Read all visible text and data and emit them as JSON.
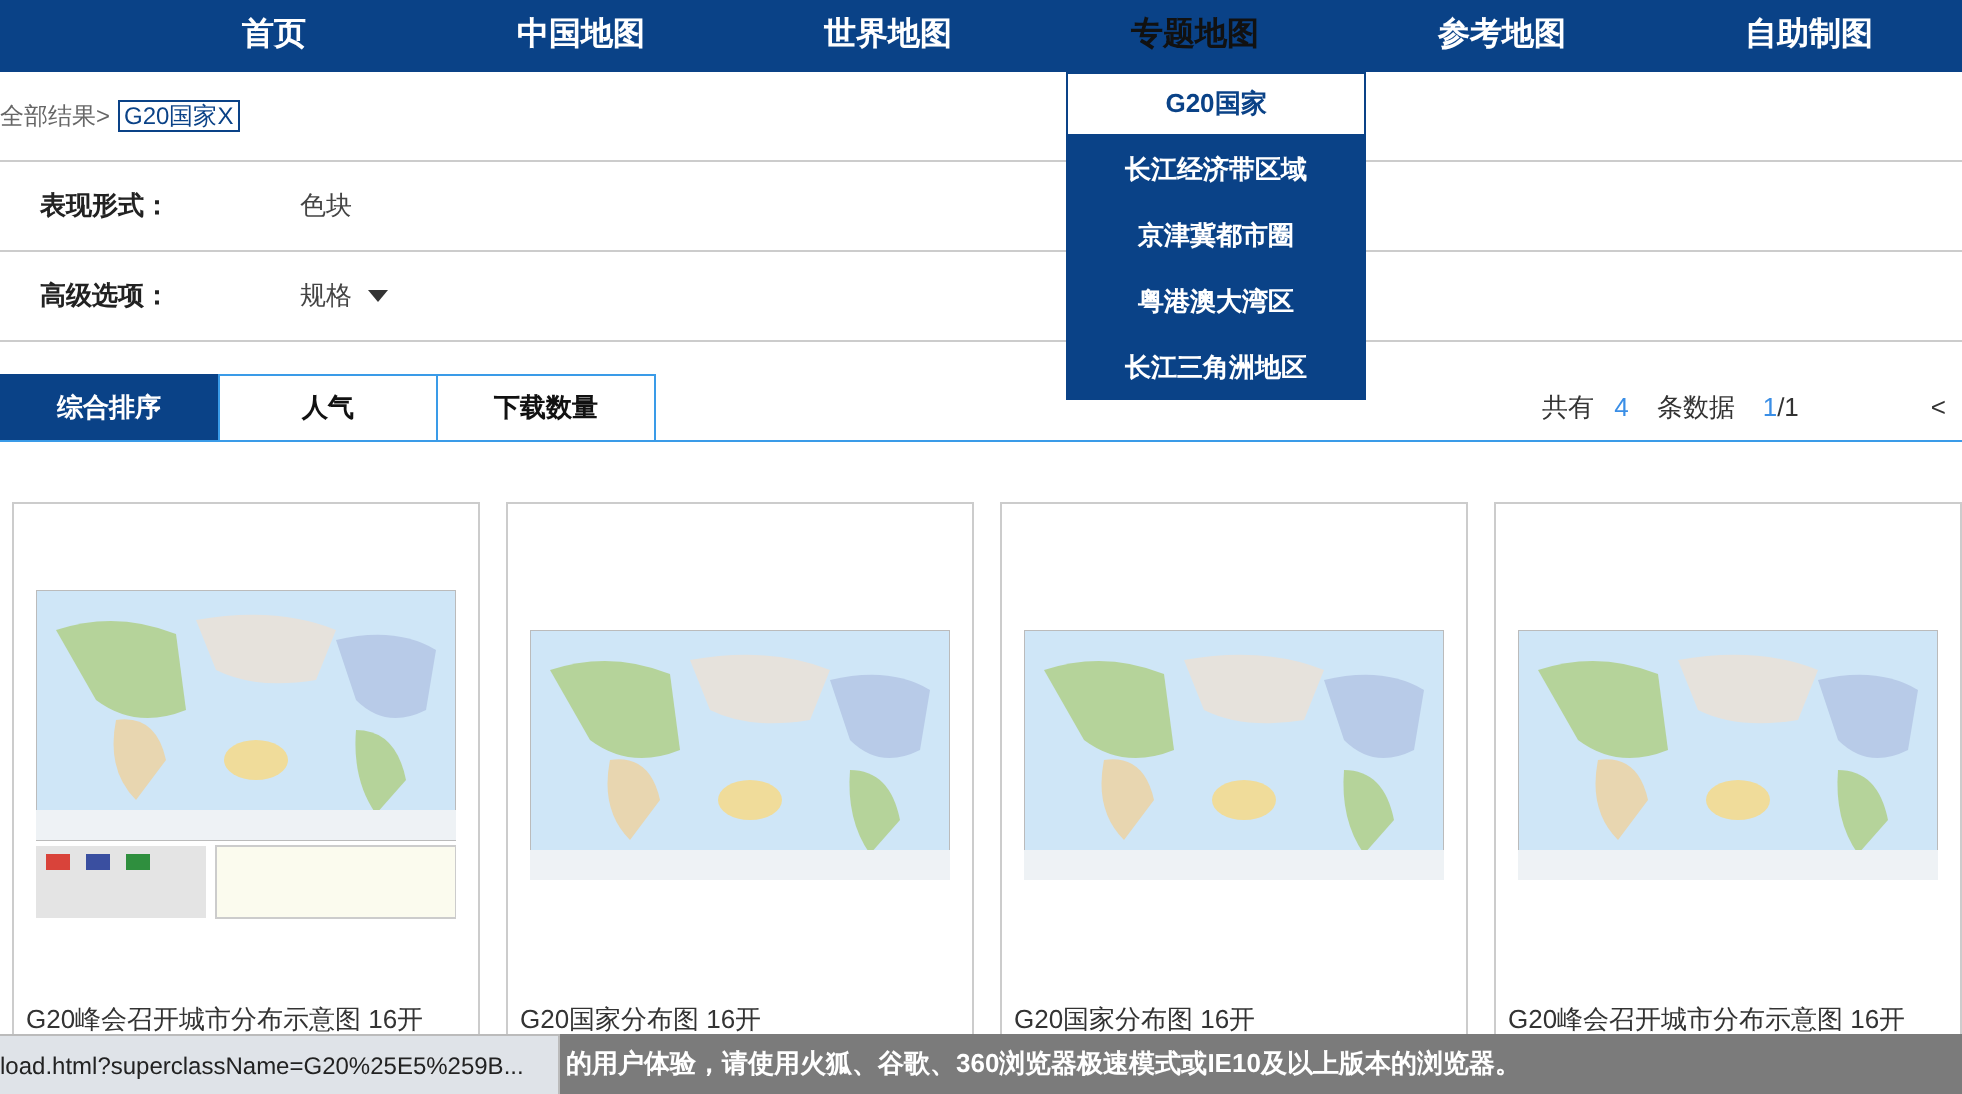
{
  "nav": [
    {
      "label": "首页",
      "selected": false
    },
    {
      "label": "中国地图",
      "selected": false
    },
    {
      "label": "世界地图",
      "selected": false
    },
    {
      "label": "专题地图",
      "selected": true
    },
    {
      "label": "参考地图",
      "selected": false
    },
    {
      "label": "自助制图",
      "selected": false
    }
  ],
  "dropdown": [
    {
      "label": "G20国家",
      "selected": true
    },
    {
      "label": "长江经济带区域",
      "selected": false
    },
    {
      "label": "京津冀都市圈",
      "selected": false
    },
    {
      "label": "粤港澳大湾区",
      "selected": false
    },
    {
      "label": "长江三角洲地区",
      "selected": false
    }
  ],
  "breadcrumb": {
    "root": "全部结果>",
    "tag": "G20国家X"
  },
  "filters": [
    {
      "label": "表现形式：",
      "value": "色块",
      "kind": "text"
    },
    {
      "label": "高级选项：",
      "value": "规格",
      "kind": "dropdown"
    }
  ],
  "sort_tabs": [
    {
      "label": "综合排序",
      "selected": true
    },
    {
      "label": "人气",
      "selected": false
    },
    {
      "label": "下载数量",
      "selected": false
    }
  ],
  "summary": {
    "prefix": "共有",
    "count": "4",
    "suffix": "条数据",
    "page": "1",
    "total": "/1",
    "prev": "<"
  },
  "cards": [
    {
      "title": "G20峰会召开城市分布示意图 16开",
      "legend": true
    },
    {
      "title": "G20国家分布图 16开",
      "legend": false
    },
    {
      "title": "G20国家分布图 16开",
      "legend": false
    },
    {
      "title": "G20峰会召开城市分布示意图 16开",
      "legend": false
    }
  ],
  "notice": "的用户体验，请使用火狐、谷歌、360浏览器极速模式或IE10及以上版本的浏览器。",
  "status_url": "load.html?superclassName=G20%25E5%259B..."
}
